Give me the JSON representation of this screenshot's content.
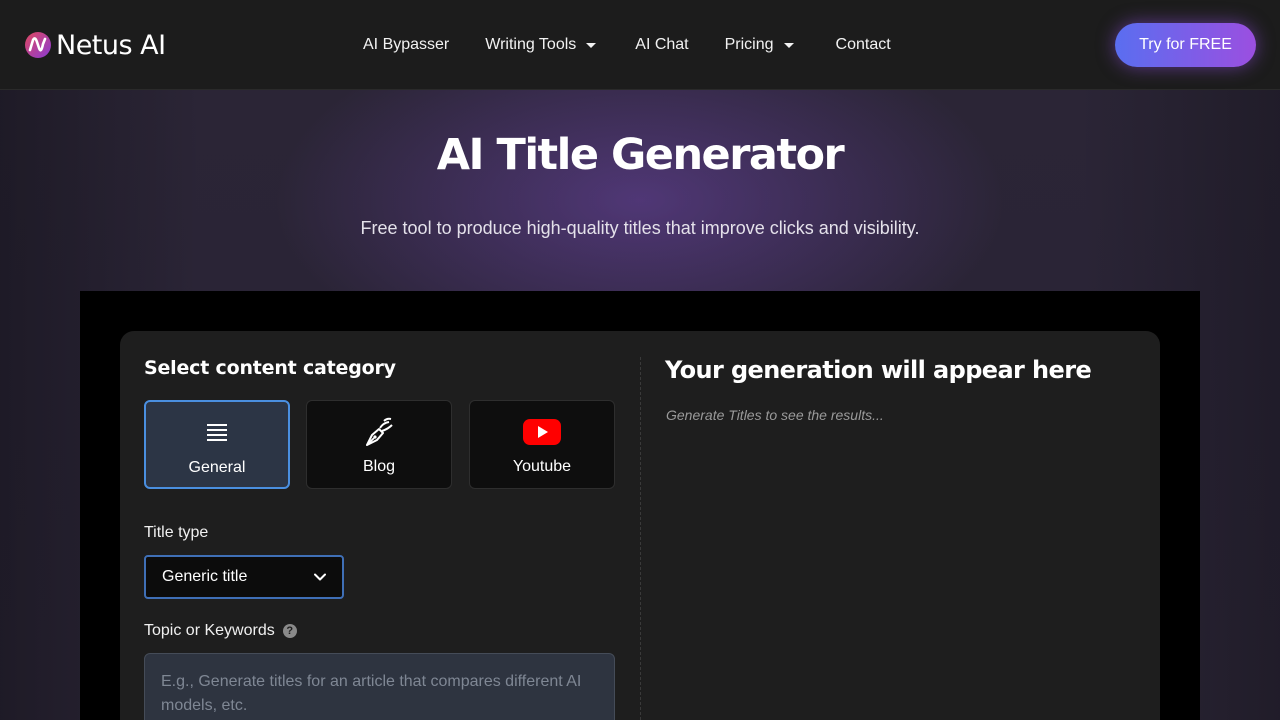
{
  "nav": {
    "brand": "Netus AI",
    "links": [
      {
        "label": "AI Bypasser",
        "dropdown": false
      },
      {
        "label": "Writing Tools",
        "dropdown": true
      },
      {
        "label": "AI Chat",
        "dropdown": false
      },
      {
        "label": "Pricing",
        "dropdown": true
      },
      {
        "label": "Contact",
        "dropdown": false
      }
    ],
    "cta": "Try for FREE"
  },
  "hero": {
    "title": "AI Title Generator",
    "subtitle": "Free tool to produce high-quality titles that improve clicks and visibility."
  },
  "form": {
    "category_heading": "Select content category",
    "categories": [
      {
        "label": "General",
        "icon": "list-icon",
        "selected": true
      },
      {
        "label": "Blog",
        "icon": "pen-nib-icon",
        "selected": false
      },
      {
        "label": "Youtube",
        "icon": "youtube-icon",
        "selected": false
      }
    ],
    "title_type_label": "Title type",
    "title_type_value": "Generic title",
    "topic_label": "Topic or Keywords",
    "topic_placeholder": "E.g., Generate titles for an article that compares different AI models, etc."
  },
  "result": {
    "heading": "Your generation will appear here",
    "placeholder": "Generate Titles to see the results..."
  },
  "colors": {
    "accent_blue": "#4a8fe0",
    "cta_gradient_start": "#5a6ef0",
    "cta_gradient_end": "#9b4fe0",
    "youtube_red": "#ff0000"
  }
}
